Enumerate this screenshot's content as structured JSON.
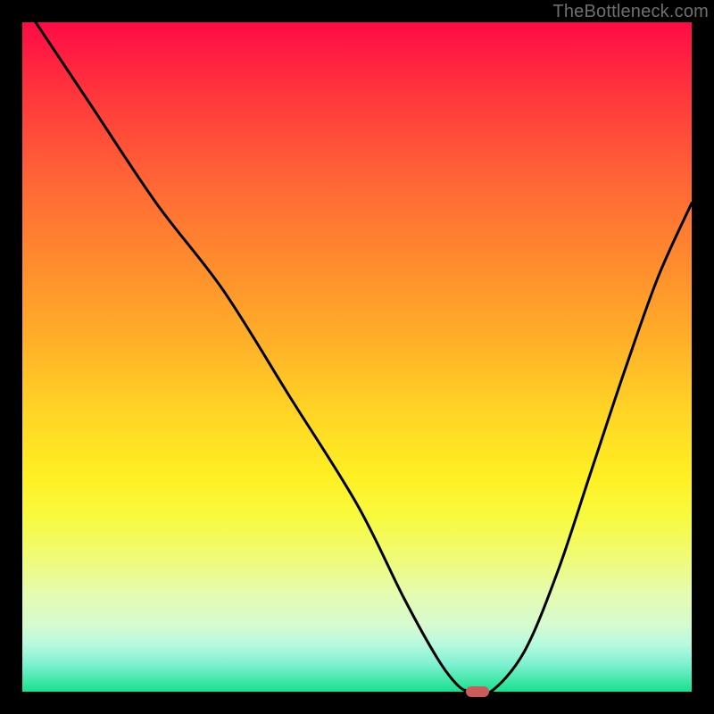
{
  "watermark": "TheBottleneck.com",
  "chart_data": {
    "type": "line",
    "title": "",
    "xlabel": "",
    "ylabel": "",
    "xlim": [
      0,
      100
    ],
    "ylim": [
      0,
      100
    ],
    "grid": false,
    "series": [
      {
        "name": "curve",
        "x": [
          2,
          10,
          20,
          30,
          40,
          50,
          57,
          62,
          65,
          67,
          70,
          75,
          80,
          85,
          90,
          95,
          100
        ],
        "values": [
          100,
          88,
          73,
          60,
          44,
          28,
          14,
          5,
          1,
          0,
          0,
          6,
          18,
          33,
          48,
          62,
          73
        ]
      }
    ],
    "marker": {
      "x": 68,
      "y": 0,
      "color": "#cc5b5c"
    },
    "gradient_stops": [
      {
        "pos": 0,
        "color": "#ff0b46"
      },
      {
        "pos": 12,
        "color": "#ff3b3b"
      },
      {
        "pos": 25,
        "color": "#ff6a35"
      },
      {
        "pos": 37,
        "color": "#ff8f2d"
      },
      {
        "pos": 48,
        "color": "#ffb128"
      },
      {
        "pos": 58,
        "color": "#ffd425"
      },
      {
        "pos": 68,
        "color": "#fff024"
      },
      {
        "pos": 74,
        "color": "#f8fa3f"
      },
      {
        "pos": 80,
        "color": "#f0fb76"
      },
      {
        "pos": 85,
        "color": "#e6fbad"
      },
      {
        "pos": 90,
        "color": "#d6fbd0"
      },
      {
        "pos": 93,
        "color": "#b6f9df"
      },
      {
        "pos": 96,
        "color": "#7cf0cf"
      },
      {
        "pos": 100,
        "color": "#18e08f"
      }
    ]
  }
}
